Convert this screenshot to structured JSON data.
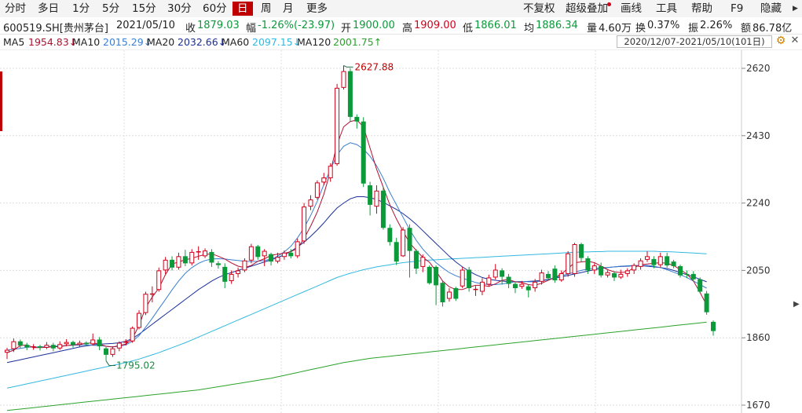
{
  "toolbar": {
    "tabs": [
      "分时",
      "多日",
      "1分",
      "5分",
      "15分",
      "30分",
      "60分",
      "日",
      "周",
      "月",
      "更多"
    ],
    "active_tab": "日",
    "right_items": [
      "不复权",
      "超级叠加",
      "画线",
      "工具",
      "帮助",
      "F9",
      "隐藏"
    ]
  },
  "info": {
    "symbol": "600519.SH[贵州茅台]",
    "date": "2021/05/10",
    "close_label": "收",
    "close": "1879.03",
    "change_label": "幅",
    "change": "-1.26%(-23.97)",
    "open_label": "开",
    "open": "1900.00",
    "high_label": "高",
    "high": "1909.00",
    "low_label": "低",
    "low": "1866.01",
    "avg_label": "均",
    "avg": "1886.34",
    "vol_label": "量",
    "vol": "4.60万",
    "turnover_label": "换",
    "turnover": "0.37%",
    "amp_label": "振",
    "amp": "2.26%",
    "amount_label": "额",
    "amount": "86.78亿"
  },
  "ma_bar": {
    "ma5_label": "MA5",
    "ma5": "1954.83↓",
    "ma10_label": "MA10",
    "ma10": "2015.29↓",
    "ma20_label": "MA20",
    "ma20": "2032.66↓",
    "ma60_label": "MA60",
    "ma60": "2097.15↓",
    "ma120_label": "MA120",
    "ma120": "2001.75↑",
    "range": "2020/12/07-2021/05/10(101日)"
  },
  "colors": {
    "up": "#d0021b",
    "down": "#0a9a3a",
    "ma5": "#b01030",
    "ma10": "#3a7fd0",
    "ma20": "#1a2f9a",
    "ma60": "#33b8e0",
    "ma120": "#2aa32a"
  },
  "chart_data": {
    "type": "candlestick",
    "ylim": [
      1650,
      2700
    ],
    "y_ticks": [
      1670,
      1860,
      2050,
      2240,
      2430,
      2620
    ],
    "y_tick_labels": [
      "1670",
      "1860",
      "2050",
      "2240",
      "2430",
      "2620"
    ],
    "max_label": "2627.88",
    "min_label": "1795.02",
    "candles": [
      [
        1818,
        1826,
        1800,
        1832
      ],
      [
        1828,
        1850,
        1820,
        1858
      ],
      [
        1850,
        1838,
        1830,
        1855
      ],
      [
        1840,
        1833,
        1825,
        1846
      ],
      [
        1833,
        1836,
        1826,
        1842
      ],
      [
        1836,
        1832,
        1824,
        1840
      ],
      [
        1832,
        1840,
        1828,
        1848
      ],
      [
        1840,
        1830,
        1822,
        1846
      ],
      [
        1830,
        1842,
        1826,
        1850
      ],
      [
        1842,
        1848,
        1836,
        1856
      ],
      [
        1848,
        1840,
        1832,
        1852
      ],
      [
        1840,
        1846,
        1834,
        1852
      ],
      [
        1846,
        1842,
        1836,
        1850
      ],
      [
        1842,
        1855,
        1838,
        1872
      ],
      [
        1855,
        1836,
        1825,
        1862
      ],
      [
        1830,
        1812,
        1795,
        1834
      ],
      [
        1812,
        1830,
        1806,
        1836
      ],
      [
        1830,
        1846,
        1822,
        1850
      ],
      [
        1846,
        1850,
        1838,
        1856
      ],
      [
        1850,
        1888,
        1846,
        1892
      ],
      [
        1888,
        1930,
        1884,
        1938
      ],
      [
        1930,
        1984,
        1924,
        1990
      ],
      [
        1985,
        1985,
        1960,
        2005
      ],
      [
        1995,
        2050,
        1990,
        2058
      ],
      [
        2050,
        2080,
        2040,
        2088
      ],
      [
        2080,
        2058,
        2050,
        2090
      ],
      [
        2058,
        2090,
        2052,
        2100
      ],
      [
        2090,
        2070,
        2062,
        2108
      ],
      [
        2070,
        2102,
        2064,
        2110
      ],
      [
        2104,
        2104,
        2080,
        2118
      ],
      [
        2090,
        2106,
        2085,
        2112
      ],
      [
        2102,
        2072,
        2060,
        2110
      ],
      [
        2070,
        2065,
        2055,
        2076
      ],
      [
        2060,
        2018,
        2000,
        2070
      ],
      [
        2020,
        2040,
        2012,
        2050
      ],
      [
        2040,
        2050,
        2030,
        2058
      ],
      [
        2050,
        2078,
        2045,
        2084
      ],
      [
        2078,
        2118,
        2070,
        2125
      ],
      [
        2118,
        2088,
        2080,
        2122
      ],
      [
        2090,
        2105,
        2062,
        2110
      ],
      [
        2096,
        2075,
        2064,
        2100
      ],
      [
        2075,
        2088,
        2070,
        2100
      ],
      [
        2088,
        2100,
        2080,
        2106
      ],
      [
        2100,
        2090,
        2084,
        2110
      ],
      [
        2090,
        2132,
        2085,
        2140
      ],
      [
        2132,
        2230,
        2125,
        2240
      ],
      [
        2230,
        2250,
        2220,
        2262
      ],
      [
        2255,
        2298,
        2250,
        2304
      ],
      [
        2298,
        2312,
        2290,
        2325
      ],
      [
        2310,
        2345,
        2300,
        2352
      ],
      [
        2350,
        2565,
        2345,
        2576
      ],
      [
        2565,
        2612,
        2560,
        2628
      ],
      [
        2612,
        2483,
        2470,
        2620
      ],
      [
        2483,
        2470,
        2450,
        2490
      ],
      [
        2470,
        2295,
        2285,
        2482
      ],
      [
        2290,
        2235,
        2205,
        2300
      ],
      [
        2230,
        2275,
        2210,
        2290
      ],
      [
        2275,
        2170,
        2165,
        2285
      ],
      [
        2170,
        2130,
        2120,
        2180
      ],
      [
        2130,
        2075,
        2065,
        2142
      ],
      [
        2090,
        2165,
        2088,
        2172
      ],
      [
        2170,
        2105,
        2030,
        2180
      ],
      [
        2105,
        2055,
        2040,
        2110
      ],
      [
        2060,
        2088,
        2045,
        2095
      ],
      [
        2060,
        2014,
        2010,
        2064
      ],
      [
        2060,
        2008,
        1952,
        2064
      ],
      [
        2015,
        1960,
        1948,
        2022
      ],
      [
        1970,
        1990,
        1962,
        2000
      ],
      [
        2000,
        1970,
        1964,
        2004
      ],
      [
        2005,
        2052,
        2000,
        2060
      ],
      [
        2052,
        2000,
        1990,
        2060
      ],
      [
        1995,
        1998,
        1978,
        2006
      ],
      [
        1990,
        2018,
        1980,
        2028
      ],
      [
        2010,
        2030,
        2004,
        2038
      ],
      [
        2030,
        2052,
        2024,
        2068
      ],
      [
        2050,
        2032,
        2010,
        2056
      ],
      [
        2032,
        2012,
        2000,
        2040
      ],
      [
        2012,
        2000,
        1986,
        2018
      ],
      [
        2004,
        2012,
        1998,
        2020
      ],
      [
        2005,
        1994,
        1974,
        2010
      ],
      [
        2000,
        2018,
        1990,
        2026
      ],
      [
        2018,
        2044,
        2010,
        2052
      ],
      [
        2040,
        2028,
        2022,
        2048
      ],
      [
        2055,
        2022,
        2015,
        2064
      ],
      [
        2022,
        2042,
        2018,
        2050
      ],
      [
        2040,
        2098,
        2032,
        2104
      ],
      [
        2040,
        2124,
        2032,
        2128
      ],
      [
        2124,
        2085,
        2074,
        2128
      ],
      [
        2084,
        2050,
        2040,
        2090
      ],
      [
        2050,
        2064,
        2040,
        2070
      ],
      [
        2062,
        2036,
        2030,
        2072
      ],
      [
        2036,
        2045,
        2030,
        2050
      ],
      [
        2042,
        2030,
        2020,
        2048
      ],
      [
        2030,
        2040,
        2026,
        2052
      ],
      [
        2040,
        2050,
        2032,
        2056
      ],
      [
        2050,
        2065,
        2040,
        2070
      ],
      [
        2060,
        2078,
        2052,
        2084
      ],
      [
        2080,
        2090,
        2074,
        2104
      ],
      [
        2082,
        2065,
        2056,
        2090
      ],
      [
        2065,
        2090,
        2058,
        2100
      ],
      [
        2090,
        2064,
        2058,
        2100
      ],
      [
        2075,
        2062,
        2056,
        2080
      ],
      [
        2062,
        2036,
        2030,
        2066
      ],
      [
        2040,
        2038,
        2028,
        2050
      ],
      [
        2040,
        2025,
        2020,
        2048
      ],
      [
        2025,
        1990,
        1985,
        2030
      ],
      [
        1985,
        1932,
        1925,
        1992
      ],
      [
        1905,
        1879,
        1866,
        1909
      ]
    ],
    "ma5": [
      1818,
      1825,
      1838,
      1840,
      1832,
      1832,
      1833,
      1835,
      1835,
      1838,
      1840,
      1842,
      1844,
      1846,
      1842,
      1836,
      1834,
      1838,
      1842,
      1858,
      1895,
      1945,
      1975,
      2000,
      2038,
      2068,
      2074,
      2080,
      2084,
      2090,
      2095,
      2097,
      2090,
      2082,
      2071,
      2062,
      2058,
      2064,
      2076,
      2083,
      2092,
      2096,
      2098,
      2103,
      2112,
      2140,
      2175,
      2215,
      2265,
      2330,
      2405,
      2455,
      2470,
      2474,
      2455,
      2395,
      2335,
      2285,
      2235,
      2195,
      2160,
      2128,
      2106,
      2087,
      2073,
      2048,
      2020,
      2004,
      1996,
      1996,
      2003,
      2008,
      2008,
      2005,
      2012,
      2022,
      2024,
      2018,
      2016,
      2010,
      2008,
      2014,
      2022,
      2030,
      2040,
      2056,
      2072,
      2074,
      2076,
      2072,
      2062,
      2052,
      2046,
      2044,
      2046,
      2058,
      2066,
      2068,
      2070,
      2072,
      2070,
      2064,
      2052,
      2040,
      2020,
      1988,
      1952
    ],
    "ma10": [
      1825,
      1828,
      1830,
      1833,
      1834,
      1834,
      1835,
      1836,
      1837,
      1838,
      1839,
      1839,
      1840,
      1839,
      1838,
      1836,
      1834,
      1836,
      1840,
      1850,
      1866,
      1890,
      1915,
      1942,
      1968,
      1995,
      2020,
      2042,
      2058,
      2070,
      2078,
      2082,
      2083,
      2082,
      2080,
      2078,
      2076,
      2075,
      2076,
      2078,
      2082,
      2090,
      2102,
      2118,
      2142,
      2170,
      2205,
      2245,
      2292,
      2335,
      2376,
      2400,
      2410,
      2405,
      2392,
      2372,
      2345,
      2310,
      2270,
      2235,
      2200,
      2165,
      2135,
      2110,
      2090,
      2072,
      2057,
      2044,
      2035,
      2028,
      2022,
      2016,
      2012,
      2010,
      2010,
      2012,
      2015,
      2018,
      2019,
      2018,
      2018,
      2020,
      2024,
      2030,
      2035,
      2040,
      2045,
      2050,
      2054,
      2056,
      2058,
      2058,
      2060,
      2062,
      2063,
      2064,
      2064,
      2064,
      2062,
      2058,
      2052,
      2045,
      2038,
      2030,
      2020,
      2010,
      2000
    ],
    "ma20": [
      1790,
      1794,
      1798,
      1802,
      1806,
      1810,
      1814,
      1818,
      1822,
      1826,
      1830,
      1834,
      1837,
      1840,
      1842,
      1843,
      1844,
      1846,
      1850,
      1858,
      1870,
      1884,
      1898,
      1912,
      1926,
      1940,
      1954,
      1968,
      1982,
      1996,
      2008,
      2020,
      2030,
      2038,
      2044,
      2050,
      2056,
      2062,
      2068,
      2074,
      2080,
      2086,
      2094,
      2104,
      2116,
      2130,
      2146,
      2164,
      2184,
      2206,
      2226,
      2240,
      2252,
      2258,
      2258,
      2255,
      2250,
      2242,
      2232,
      2222,
      2210,
      2196,
      2180,
      2162,
      2144,
      2126,
      2108,
      2090,
      2074,
      2060,
      2048,
      2038,
      2030,
      2025,
      2022,
      2020,
      2018,
      2018,
      2018,
      2019,
      2020,
      2022,
      2025,
      2028,
      2032,
      2036,
      2040,
      2044,
      2048,
      2052,
      2055,
      2058,
      2060,
      2061,
      2062,
      2063,
      2063,
      2062,
      2060,
      2058,
      2055,
      2050,
      2044,
      2038,
      2032,
      2025,
      2018
    ],
    "ma60": [
      1718,
      1722,
      1726,
      1730,
      1734,
      1738,
      1742,
      1746,
      1750,
      1754,
      1758,
      1762,
      1766,
      1770,
      1774,
      1778,
      1782,
      1786,
      1790,
      1795,
      1800,
      1806,
      1812,
      1818,
      1825,
      1832,
      1839,
      1846,
      1854,
      1862,
      1870,
      1878,
      1886,
      1894,
      1902,
      1910,
      1918,
      1926,
      1934,
      1942,
      1950,
      1958,
      1966,
      1974,
      1982,
      1990,
      1998,
      2006,
      2014,
      2022,
      2030,
      2036,
      2042,
      2047,
      2052,
      2056,
      2060,
      2063,
      2066,
      2069,
      2072,
      2074,
      2076,
      2078,
      2079,
      2080,
      2081,
      2082,
      2083,
      2084,
      2085,
      2086,
      2087,
      2088,
      2089,
      2090,
      2091,
      2092,
      2093,
      2094,
      2095,
      2096,
      2097,
      2098,
      2099,
      2100,
      2101,
      2102,
      2102,
      2103,
      2103,
      2104,
      2104,
      2104,
      2104,
      2104,
      2104,
      2104,
      2104,
      2103,
      2103,
      2102,
      2101,
      2100,
      2099,
      2098,
      2097
    ],
    "ma120": [
      1655,
      1657,
      1659,
      1661,
      1663,
      1665,
      1667,
      1669,
      1671,
      1673,
      1675,
      1677,
      1679,
      1681,
      1683,
      1685,
      1687,
      1689,
      1691,
      1693,
      1695,
      1697,
      1699,
      1701,
      1703,
      1705,
      1707,
      1709,
      1711,
      1713,
      1716,
      1719,
      1722,
      1725,
      1728,
      1731,
      1734,
      1737,
      1740,
      1743,
      1746,
      1750,
      1754,
      1758,
      1762,
      1766,
      1770,
      1774,
      1778,
      1782,
      1786,
      1790,
      1793,
      1796,
      1799,
      1802,
      1804,
      1806,
      1808,
      1810,
      1812,
      1814,
      1816,
      1818,
      1820,
      1822,
      1824,
      1826,
      1828,
      1830,
      1832,
      1834,
      1836,
      1838,
      1840,
      1842,
      1844,
      1846,
      1848,
      1850,
      1852,
      1854,
      1856,
      1858,
      1860,
      1862,
      1864,
      1866,
      1868,
      1870,
      1872,
      1874,
      1876,
      1878,
      1880,
      1882,
      1884,
      1886,
      1888,
      1890,
      1892,
      1894,
      1896,
      1898,
      1900,
      1902,
      1904
    ]
  }
}
